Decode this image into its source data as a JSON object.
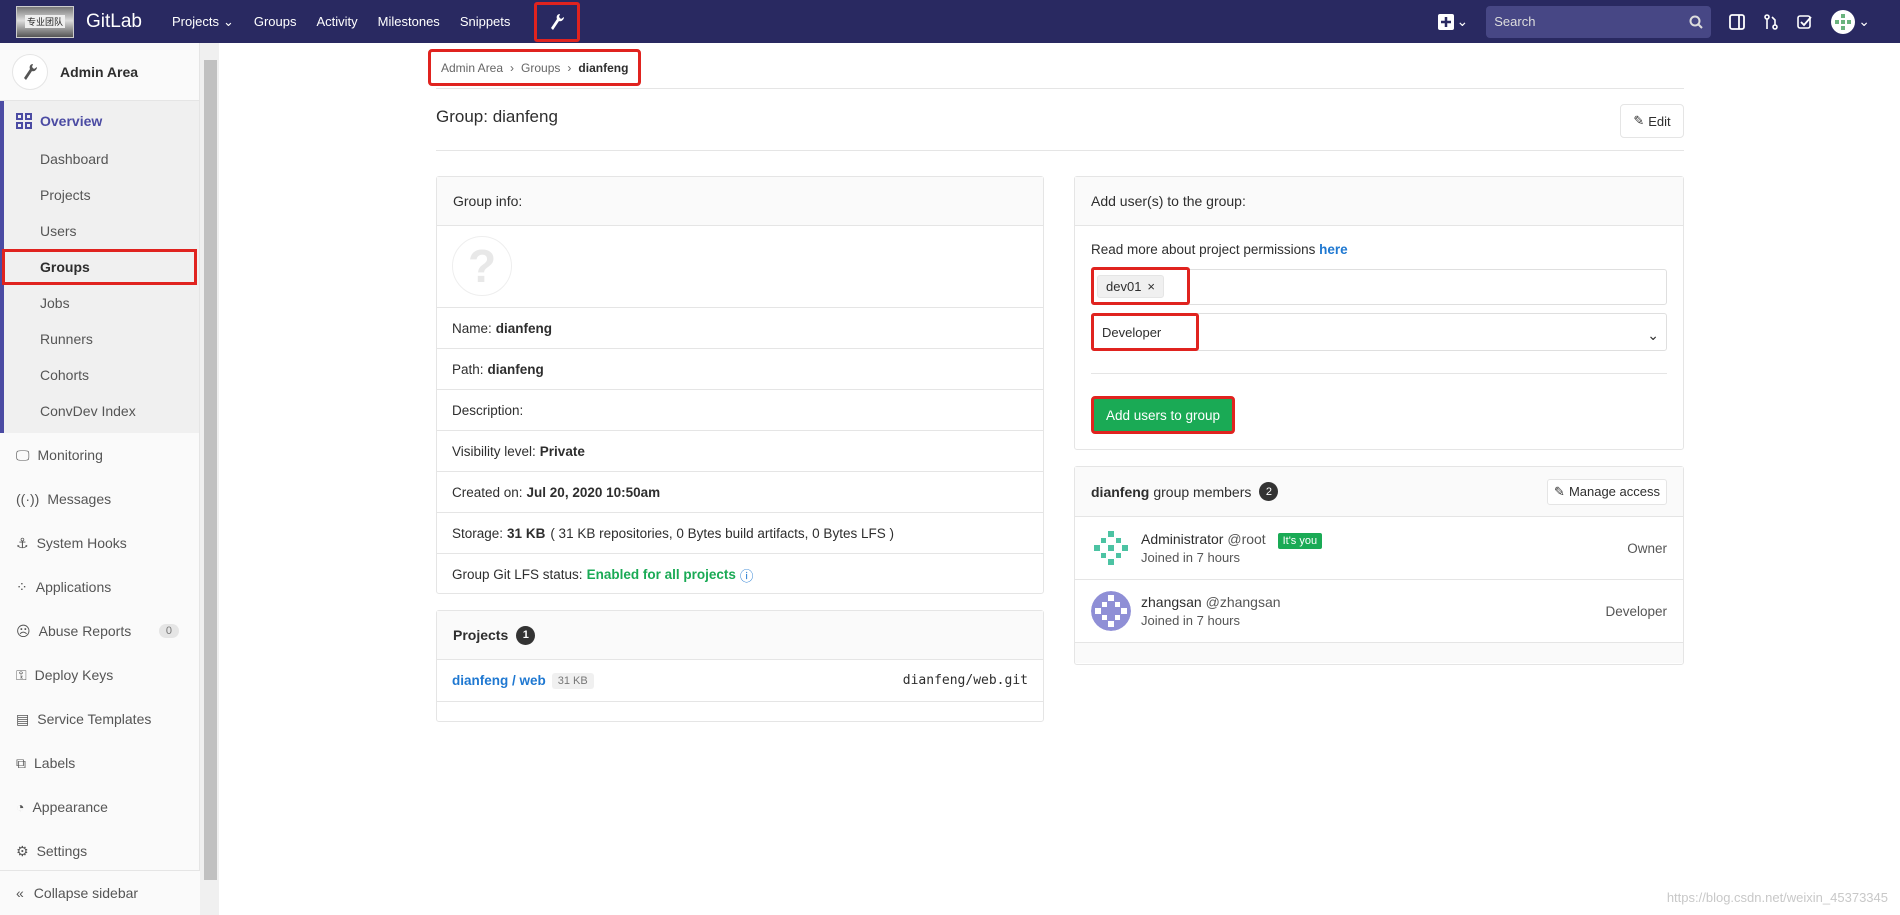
{
  "navbar": {
    "brand": "GitLab",
    "logo_text": "专业团队",
    "links": [
      "Projects",
      "Groups",
      "Activity",
      "Milestones",
      "Snippets"
    ],
    "search_placeholder": "Search"
  },
  "sidebar": {
    "title": "Admin Area",
    "overview": "Overview",
    "sub_items": [
      "Dashboard",
      "Projects",
      "Users",
      "Groups",
      "Jobs",
      "Runners",
      "Cohorts",
      "ConvDev Index"
    ],
    "items": [
      "Monitoring",
      "Messages",
      "System Hooks",
      "Applications",
      "Abuse Reports",
      "Deploy Keys",
      "Service Templates",
      "Labels",
      "Appearance",
      "Settings"
    ],
    "abuse_count": "0",
    "collapse": "Collapse sidebar"
  },
  "breadcrumb": {
    "root": "Admin Area",
    "mid": "Groups",
    "current": "dianfeng"
  },
  "page": {
    "title": "Group: dianfeng",
    "edit": "Edit"
  },
  "group_info": {
    "header": "Group info:",
    "name_label": "Name:",
    "name": "dianfeng",
    "path_label": "Path:",
    "path": "dianfeng",
    "description_label": "Description:",
    "visibility_label": "Visibility level:",
    "visibility": "Private",
    "created_label": "Created on:",
    "created": "Jul 20, 2020 10:50am",
    "storage_label": "Storage:",
    "storage": "31 KB",
    "storage_detail": "( 31 KB repositories, 0 Bytes build artifacts, 0 Bytes LFS )",
    "lfs_label": "Group Git LFS status:",
    "lfs": "Enabled for all projects"
  },
  "projects": {
    "header": "Projects",
    "count": "1",
    "name": "dianfeng / web",
    "size": "31 KB",
    "git": "dianfeng/web.git"
  },
  "add_users": {
    "header": "Add user(s) to the group:",
    "read_more": "Read more about project permissions",
    "here": "here",
    "token": "dev01",
    "role": "Developer",
    "button": "Add users to group"
  },
  "members": {
    "group": "dianfeng",
    "label": "group members",
    "count": "2",
    "manage": "Manage access",
    "list": [
      {
        "name": "Administrator",
        "handle": "@root",
        "you": "It's you",
        "joined": "Joined in 7 hours",
        "role": "Owner"
      },
      {
        "name": "zhangsan",
        "handle": "@zhangsan",
        "joined": "Joined in 7 hours",
        "role": "Developer"
      }
    ]
  },
  "watermark": "https://blog.csdn.net/weixin_45373345",
  "colors": {
    "nav": "#292961",
    "accent": "#4b4ba3",
    "green": "#1aaa55",
    "highlight": "#e0231f"
  }
}
